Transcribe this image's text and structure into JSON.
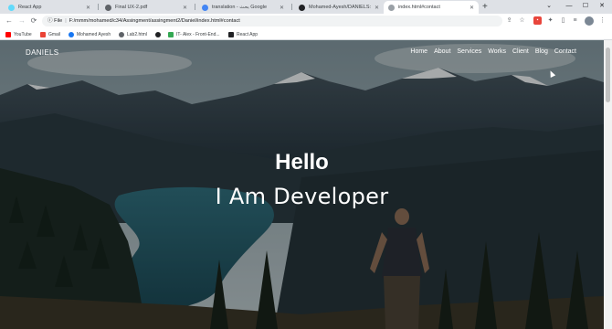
{
  "tabs": [
    {
      "title": "React App",
      "favicon": "#61dafb",
      "active": false
    },
    {
      "title": "Final UX-2.pdf",
      "favicon": "#5f6368",
      "active": false
    },
    {
      "title": "translation - بحث Google",
      "favicon": "#4285f4",
      "active": false
    },
    {
      "title": "Mohamed-Ayesh/DANIELS: It's a",
      "favicon": "#202124",
      "active": false
    },
    {
      "title": "index.html#contact",
      "favicon": "#9aa0a6",
      "active": true
    }
  ],
  "window_controls": {
    "minimize": "—",
    "maximize": "☐",
    "close": "✕",
    "dropdown": "⌄"
  },
  "toolbar": {
    "back": "←",
    "forward": "→",
    "reload": "⟳",
    "scheme": "File",
    "url": "F:/mmm/mohamed/c34/Assingment/assingment2/Daniel/index.html#contact"
  },
  "bookmarks": [
    {
      "label": "YouTube",
      "color": "#ff0000"
    },
    {
      "label": "Gmail",
      "color": "#ea4335"
    },
    {
      "label": "Mohamed Ayesh",
      "color": "#1877f2"
    },
    {
      "label": "Lab2.html",
      "color": "#5f6368"
    },
    {
      "label": "",
      "color": "#202124"
    },
    {
      "label": "IT- Alex - Front-End...",
      "color": "#34a853"
    },
    {
      "label": "React App",
      "color": "#202124"
    }
  ],
  "site": {
    "brand": "DANIELS",
    "nav": [
      "Home",
      "About",
      "Services",
      "Works",
      "Client",
      "Blog",
      "Contact"
    ],
    "hero_title": "Hello",
    "hero_subtitle": "I Am Developer"
  }
}
